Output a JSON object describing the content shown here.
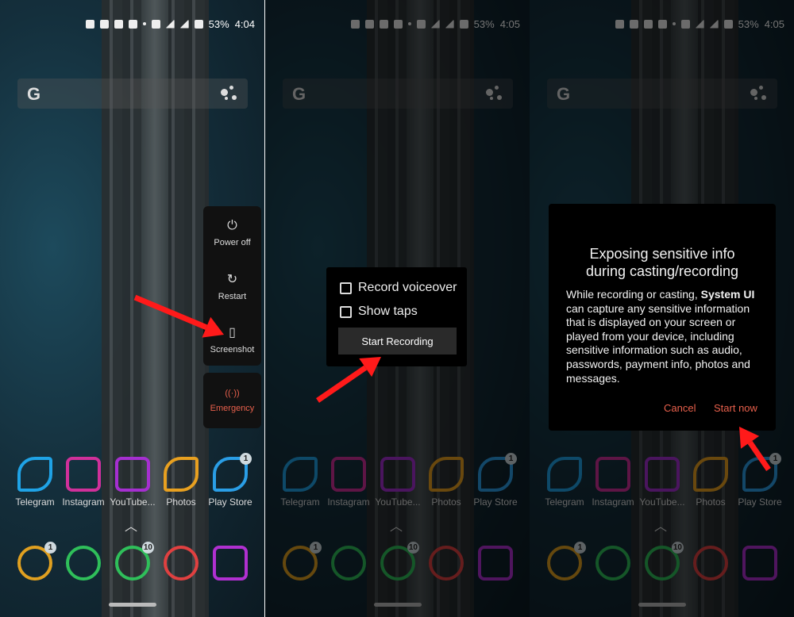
{
  "panels": [
    {
      "status": {
        "battery": "53%",
        "time": "4:04"
      }
    },
    {
      "status": {
        "battery": "53%",
        "time": "4:05"
      }
    },
    {
      "status": {
        "battery": "53%",
        "time": "4:05"
      }
    }
  ],
  "search": {
    "logo": "G"
  },
  "apps": [
    {
      "label": "Telegram",
      "color": "#1fa3e6",
      "badge": ""
    },
    {
      "label": "Instagram",
      "color": "#d0309a",
      "badge": ""
    },
    {
      "label": "YouTube...",
      "color": "#a52fd0",
      "badge": ""
    },
    {
      "label": "Photos",
      "color": "#e8a020",
      "badge": ""
    },
    {
      "label": "Play Store",
      "color": "#2a9ee6",
      "badge": "1"
    }
  ],
  "dock": [
    {
      "name": "messages",
      "color": "#e0a020",
      "badge": "1"
    },
    {
      "name": "phone",
      "color": "#2fbf5a",
      "badge": ""
    },
    {
      "name": "whatsapp",
      "color": "#2fbf5a",
      "badge": "10"
    },
    {
      "name": "chrome",
      "color": "#e04040",
      "badge": ""
    },
    {
      "name": "camera",
      "color": "#b030d0",
      "badge": ""
    }
  ],
  "power_menu": {
    "items": [
      {
        "label": "Power off",
        "icon": "power-icon",
        "glyph": "⏻"
      },
      {
        "label": "Restart",
        "icon": "restart-icon",
        "glyph": "↻"
      },
      {
        "label": "Screenshot",
        "icon": "screenshot-icon",
        "glyph": "▯"
      }
    ],
    "emergency": {
      "label": "Emergency",
      "glyph": "((·))"
    }
  },
  "recording_dialog": {
    "options": [
      {
        "label": "Record voiceover",
        "checked": false
      },
      {
        "label": "Show taps",
        "checked": false
      }
    ],
    "start_button": "Start Recording"
  },
  "cast_dialog": {
    "title_line1": "Exposing sensitive info",
    "title_line2": "during casting/recording",
    "body_pre": "While recording or casting, ",
    "body_bold": "System UI",
    "body_post": " can capture any sensitive information that is displayed on your screen or played from your device, including sensitive information such as audio, passwords, payment info, photos and messages.",
    "cancel": "Cancel",
    "start": "Start now",
    "accent": "#e8604c"
  },
  "annotation_arrow_color": "#ff1a1a"
}
